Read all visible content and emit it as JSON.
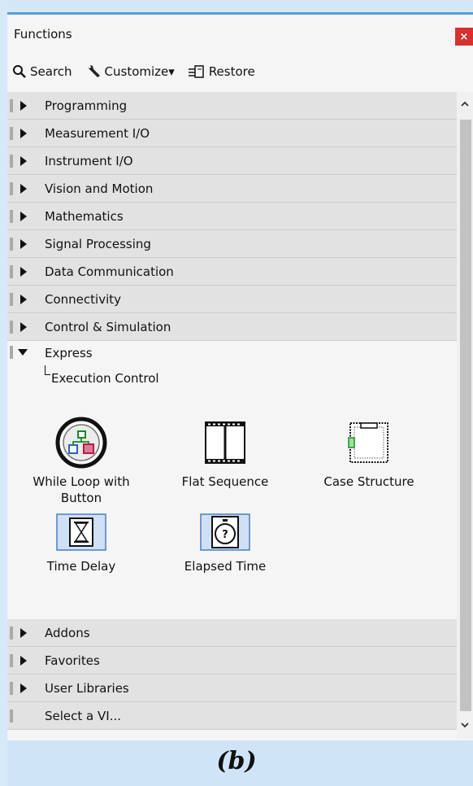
{
  "palette": {
    "title": "Functions",
    "close": "×",
    "toolbar": {
      "search": "Search",
      "customize": "Customize▾",
      "restore": "Restore"
    },
    "categories_top": [
      "Programming",
      "Measurement I/O",
      "Instrument I/O",
      "Vision and Motion",
      "Mathematics",
      "Signal Processing",
      "Data Communication",
      "Connectivity",
      "Control & Simulation"
    ],
    "expanded": {
      "label": "Express",
      "subpalette": "Execution Control",
      "items": [
        {
          "label1": "While Loop with",
          "label2": "Button",
          "icon": "while-loop-icon"
        },
        {
          "label1": "Flat Sequence",
          "label2": "",
          "icon": "flat-sequence-icon"
        },
        {
          "label1": "Case Structure",
          "label2": "",
          "icon": "case-structure-icon"
        },
        {
          "label1": "Time Delay",
          "label2": "",
          "icon": "time-delay-icon"
        },
        {
          "label1": "Elapsed Time",
          "label2": "",
          "icon": "elapsed-time-icon"
        }
      ]
    },
    "categories_bottom": [
      "Addons",
      "Favorites",
      "User Libraries",
      "Select a VI..."
    ]
  },
  "caption": "(b)",
  "colors": {
    "accent_blue": "#5b9bd5",
    "close_red": "#d9312b",
    "row_bg": "#e2e2e2",
    "selected_icon_bg": "#cfe0f5"
  }
}
